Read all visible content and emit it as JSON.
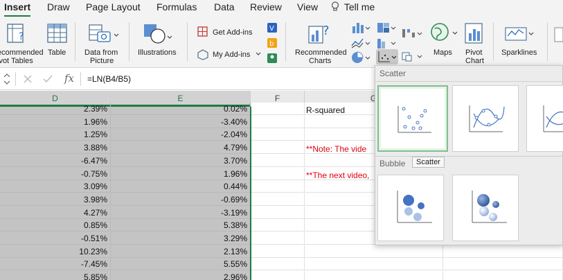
{
  "tabs": [
    "Insert",
    "Draw",
    "Page Layout",
    "Formulas",
    "Data",
    "Review",
    "View",
    "Tell me"
  ],
  "ribbon": {
    "pivot_label": [
      "ecommended",
      "ivot Tables"
    ],
    "table_label": "Table",
    "data_from_picture_label": [
      "Data from",
      "Picture"
    ],
    "illustrations_label": "Illustrations",
    "get_addins_label": "Get Add-ins",
    "my_addins_label": "My Add-ins",
    "recommended_charts_label": [
      "Recommended",
      "Charts"
    ],
    "maps_label": "Maps",
    "pivot_chart_label": [
      "Pivot",
      "Chart"
    ],
    "sparklines_label": "Sparklines"
  },
  "formula_bar": {
    "fx": "fx",
    "formula": "=LN(B4/B5)"
  },
  "columns": {
    "d": "D",
    "e": "E",
    "f": "F",
    "g": "G"
  },
  "rows": [
    {
      "d": "2.39%",
      "e": "0.02%"
    },
    {
      "d": "1.96%",
      "e": "-3.40%"
    },
    {
      "d": "1.25%",
      "e": "-2.04%"
    },
    {
      "d": "3.88%",
      "e": "4.79%"
    },
    {
      "d": "-6.47%",
      "e": "3.70%"
    },
    {
      "d": "-0.75%",
      "e": "1.96%"
    },
    {
      "d": "3.09%",
      "e": "0.44%"
    },
    {
      "d": "3.98%",
      "e": "-0.69%"
    },
    {
      "d": "4.27%",
      "e": "-3.19%"
    },
    {
      "d": "0.85%",
      "e": "5.38%"
    },
    {
      "d": "-0.51%",
      "e": "3.29%"
    },
    {
      "d": "10.23%",
      "e": "2.13%"
    },
    {
      "d": "-7.45%",
      "e": "5.55%"
    },
    {
      "d": "5.85%",
      "e": "2.96%"
    }
  ],
  "side_text": {
    "r_squared": "R-squared",
    "note1": "**Note:  The vide",
    "note2": "**The next video,"
  },
  "dropdown": {
    "scatter_heading": "Scatter",
    "bubble_heading": "Bubble",
    "tooltip": "Scatter"
  },
  "colors": {
    "accent": "#1d7a45",
    "note_red": "#e0000f",
    "selected_fill": "#c4c4c4"
  }
}
